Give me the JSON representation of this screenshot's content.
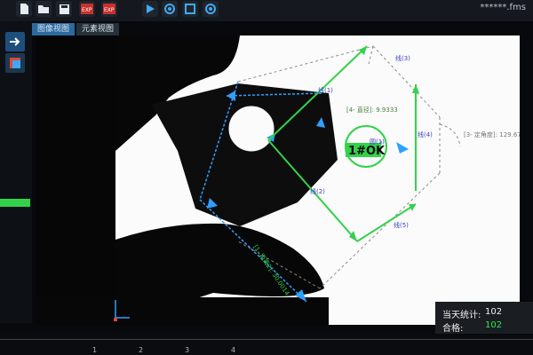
{
  "window": {
    "title": "******.fms"
  },
  "toolbar": {
    "buttons": [
      {
        "name": "new-file-button",
        "icon": "file-icon"
      },
      {
        "name": "open-folder-button",
        "icon": "folder-icon"
      },
      {
        "name": "save-button",
        "icon": "save-icon"
      },
      {
        "name": "export-button-1",
        "icon": "export-icon",
        "label": "EXP"
      },
      {
        "name": "export-button-2",
        "icon": "export-icon",
        "label": "EXP"
      },
      {
        "name": "run-button",
        "icon": "play-icon"
      },
      {
        "name": "settings-button-1",
        "icon": "gear-icon"
      },
      {
        "name": "view-button",
        "icon": "square-icon"
      },
      {
        "name": "settings-button-2",
        "icon": "gear-icon"
      }
    ]
  },
  "tabs": [
    {
      "label": "图像视图",
      "active": true
    },
    {
      "label": "元素视图",
      "active": false
    }
  ],
  "overlay": {
    "line1": "线(1)",
    "line2": "线(2)",
    "line3": "线(3)",
    "line4": "线(4)",
    "line5": "线(5)",
    "circle1": "圆(1)",
    "diameter": "[4- 直径]: 9.9333",
    "angle": "[3- 定角度]: 129.6702",
    "distance": "[1- 距离2]: 30.0014",
    "result": "1#OK"
  },
  "stats": {
    "today_label": "当天统计:",
    "today_value": "102",
    "pass_label": "合格:",
    "pass_value": "102"
  },
  "ruler": {
    "labels": [
      "1",
      "2",
      "3",
      "4"
    ]
  },
  "colors": {
    "accent_green": "#32d24a",
    "measure_blue": "#2ea0ff",
    "ok_text": "#0a0a0a"
  }
}
